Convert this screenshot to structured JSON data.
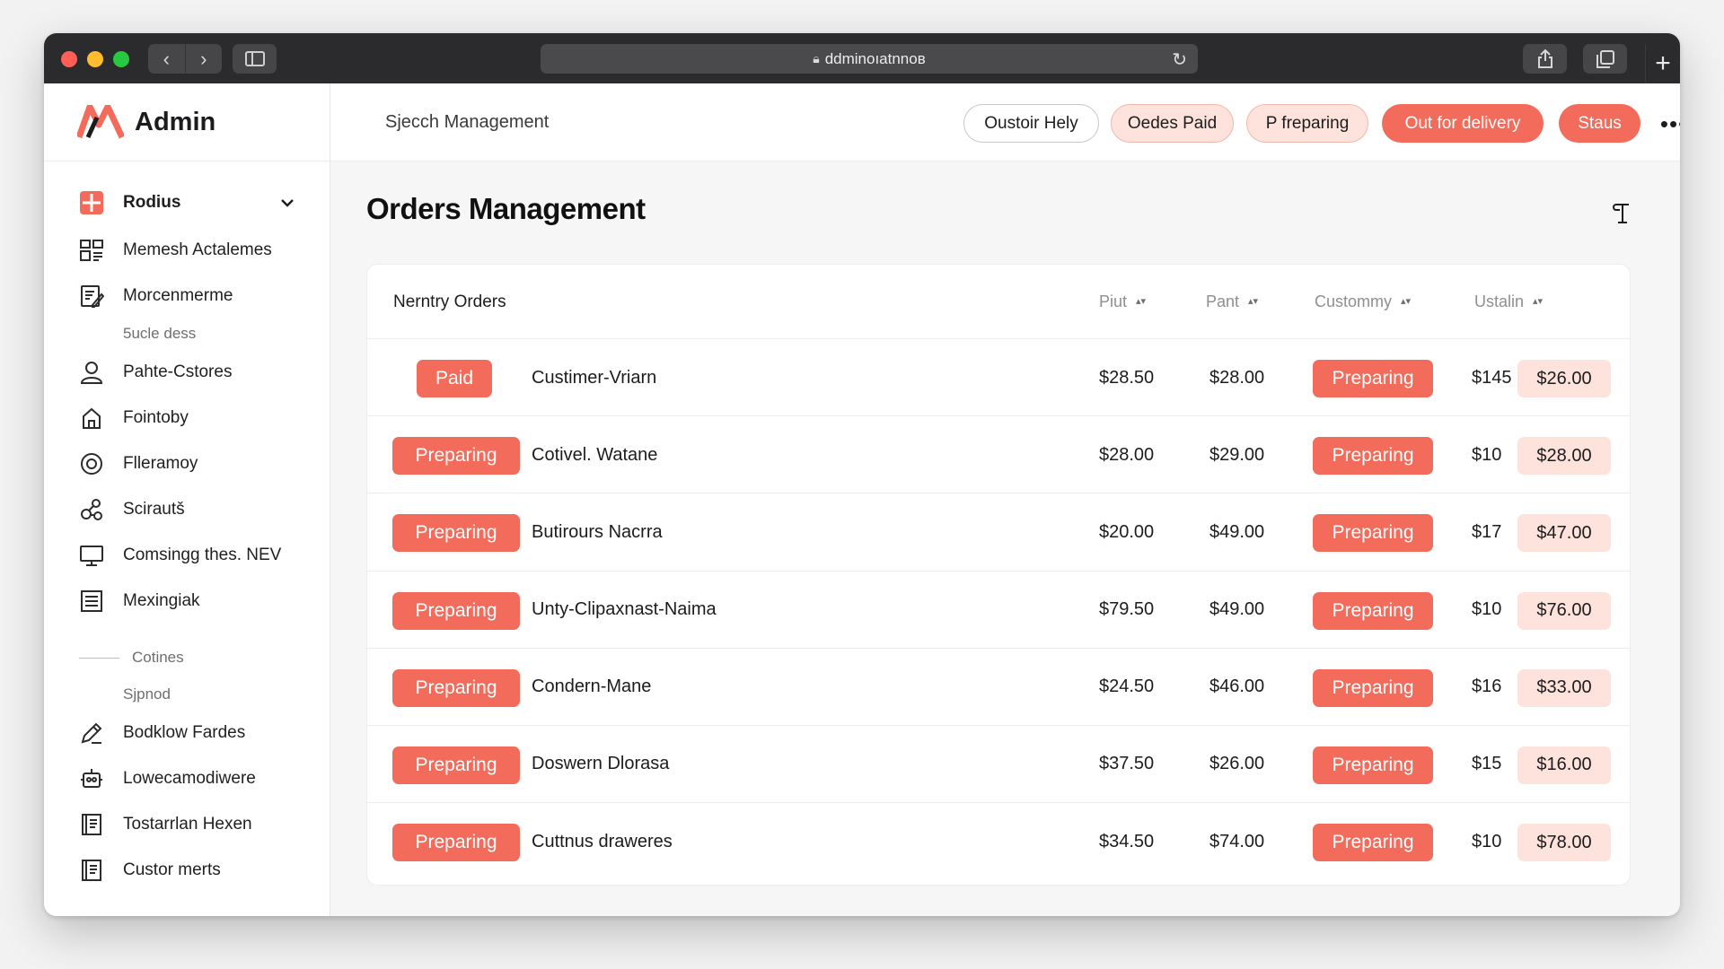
{
  "browser": {
    "url": "ddminoıatnnoʙ",
    "buttons": {
      "back": "‹",
      "forward": "›",
      "newtab": "+"
    }
  },
  "brand": {
    "name": "Admin",
    "logo_color": "#f26b5b"
  },
  "sidebar": {
    "items": [
      {
        "label": "Rodius",
        "icon": "grid-icon",
        "active": true
      },
      {
        "label": "Memesh Actalemes",
        "icon": "layout-icon"
      },
      {
        "label": "Morcenmerme",
        "icon": "document-edit-icon"
      },
      {
        "label": "5ucle dess",
        "type": "sub"
      },
      {
        "label": "Pahte-Cstores",
        "icon": "user-icon"
      },
      {
        "label": "Fointoby",
        "icon": "home-icon"
      },
      {
        "label": "Flleramoy",
        "icon": "target-icon"
      },
      {
        "label": "Scirautš",
        "icon": "network-icon"
      },
      {
        "label": "Comsingg thes. NEV",
        "icon": "monitor-icon"
      },
      {
        "label": "Mexingiak",
        "icon": "list-icon"
      },
      {
        "label": "Cotines",
        "type": "divider"
      },
      {
        "label": "Sjpnod",
        "type": "sub"
      },
      {
        "label": "Bodklow Fardes",
        "icon": "pen-icon"
      },
      {
        "label": "Lowecamodiwere",
        "icon": "robot-icon"
      },
      {
        "label": "Tostarrlan Hexen",
        "icon": "book-icon"
      },
      {
        "label": "Custor merts",
        "icon": "book-icon"
      }
    ]
  },
  "header": {
    "title": "Sjecch Management",
    "filters": [
      {
        "label": "Oustoir Hely"
      },
      {
        "label": "Oedes Paid"
      },
      {
        "label": "P freparing"
      },
      {
        "label": "Out for delivery"
      },
      {
        "label": "Staus"
      }
    ],
    "more": "•••"
  },
  "main": {
    "title": "Orders Management",
    "table": {
      "title": "Nerntry Orders",
      "columns": [
        "Piut",
        "Pant",
        "Custommy",
        "Ustalin"
      ],
      "sort_glyph": "▴▾",
      "rows": [
        {
          "lead": "Paid",
          "name": "Custimer-Vriarn",
          "v1": "$28.50",
          "v2": "$28.00",
          "status": "Preparing",
          "v3": "$145",
          "total": "$26.00"
        },
        {
          "lead": "Preparing",
          "name": "Cotivel. Watane",
          "v1": "$28.00",
          "v2": "$29.00",
          "status": "Preparing",
          "v3": "$10",
          "total": "$28.00"
        },
        {
          "lead": "Preparing",
          "name": "Butirours Nacrra",
          "v1": "$20.00",
          "v2": "$49.00",
          "status": "Preparing",
          "v3": "$17",
          "total": "$47.00"
        },
        {
          "lead": "Preparing",
          "name": "Unty-Clipaxnast-Naima",
          "v1": "$79.50",
          "v2": "$49.00",
          "status": "Preparing",
          "v3": "$10",
          "total": "$76.00"
        },
        {
          "lead": "Preparing",
          "name": "Condern-Mane",
          "v1": "$24.50",
          "v2": "$46.00",
          "status": "Preparing",
          "v3": "$16",
          "total": "$33.00"
        },
        {
          "lead": "Preparing",
          "name": "Doswern Dlorasa",
          "v1": "$37.50",
          "v2": "$26.00",
          "status": "Preparing",
          "v3": "$15",
          "total": "$16.00"
        },
        {
          "lead": "Preparing",
          "name": "Cuttnus draweres",
          "v1": "$34.50",
          "v2": "$74.00",
          "status": "Preparing",
          "v3": "$10",
          "total": "$78.00"
        }
      ]
    }
  },
  "colors": {
    "accent": "#f26b5b",
    "accent_soft": "#fde3dc",
    "chrome": "#2b2b2d"
  }
}
